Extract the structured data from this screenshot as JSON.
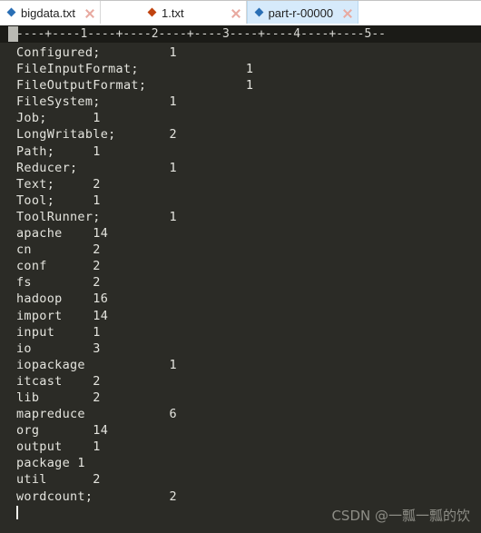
{
  "window": {
    "app_type": "text-editor",
    "background_color": "#2b2b26"
  },
  "tabbar": {
    "tabs": [
      {
        "label": "bigdata.txt",
        "icon": "file-diamond-blue-icon",
        "icon_color": "#2a6fb5",
        "active": false,
        "close_label": "×"
      },
      {
        "label": "1.txt",
        "icon": "file-diamond-orange-icon",
        "icon_color": "#c0430f",
        "active": false,
        "close_label": "×"
      },
      {
        "label": "part-r-00000",
        "icon": "file-diamond-blue-icon",
        "icon_color": "#2a6fb5",
        "active": true,
        "close_label": "×"
      }
    ],
    "active_tab": "part-r-00000",
    "active_tab_color": "#d6eafb"
  },
  "ruler": {
    "text": "----+----1----+----2----+----3----+----4----+----5--",
    "marks": [
      "1",
      "2",
      "3",
      "4",
      "5"
    ]
  },
  "editor": {
    "font": "monospace",
    "text_color": "#e4e4de",
    "lines": [
      "Configured;         1",
      "FileInputFormat;              1",
      "FileOutputFormat;             1",
      "FileSystem;         1",
      "Job;      1",
      "LongWritable;       2",
      "Path;     1",
      "Reducer;            1",
      "Text;     2",
      "Tool;     1",
      "ToolRunner;         1",
      "apache    14",
      "cn        2",
      "conf      2",
      "fs        2",
      "hadoop    16",
      "import    14",
      "input     1",
      "io        3",
      "iopackage           1",
      "itcast    2",
      "lib       2",
      "mapreduce           6",
      "org       14",
      "output    1",
      "package 1",
      "util      2",
      "wordcount;          2"
    ],
    "entries": [
      {
        "term": "Configured;",
        "count": "1"
      },
      {
        "term": "FileInputFormat;",
        "count": "1"
      },
      {
        "term": "FileOutputFormat;",
        "count": "1"
      },
      {
        "term": "FileSystem;",
        "count": "1"
      },
      {
        "term": "Job;",
        "count": "1"
      },
      {
        "term": "LongWritable;",
        "count": "2"
      },
      {
        "term": "Path;",
        "count": "1"
      },
      {
        "term": "Reducer;",
        "count": "1"
      },
      {
        "term": "Text;",
        "count": "2"
      },
      {
        "term": "Tool;",
        "count": "1"
      },
      {
        "term": "ToolRunner;",
        "count": "1"
      },
      {
        "term": "apache",
        "count": "14"
      },
      {
        "term": "cn",
        "count": "2"
      },
      {
        "term": "conf",
        "count": "2"
      },
      {
        "term": "fs",
        "count": "2"
      },
      {
        "term": "hadoop",
        "count": "16"
      },
      {
        "term": "import",
        "count": "14"
      },
      {
        "term": "input",
        "count": "1"
      },
      {
        "term": "io",
        "count": "3"
      },
      {
        "term": "iopackage",
        "count": "1"
      },
      {
        "term": "itcast",
        "count": "2"
      },
      {
        "term": "lib",
        "count": "2"
      },
      {
        "term": "mapreduce",
        "count": "6"
      },
      {
        "term": "org",
        "count": "14"
      },
      {
        "term": "output",
        "count": "1"
      },
      {
        "term": "package",
        "count": "1"
      },
      {
        "term": "util",
        "count": "2"
      },
      {
        "term": "wordcount;",
        "count": "2"
      }
    ],
    "cursor_line": 29
  },
  "watermark": {
    "text": "CSDN @一瓢一瓢的饮"
  }
}
